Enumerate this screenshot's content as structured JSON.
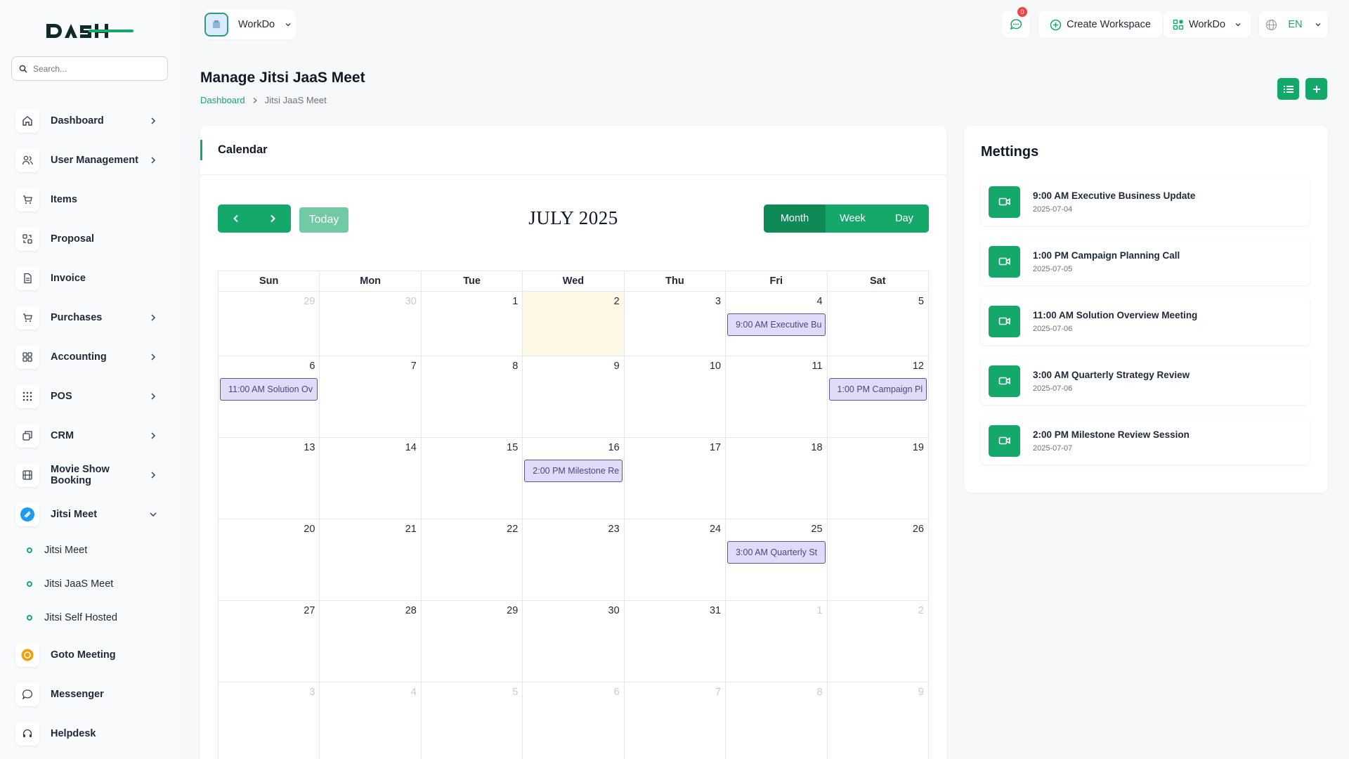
{
  "brand": {
    "logo_text": "DASH"
  },
  "sidebar": {
    "search_placeholder": "Search...",
    "items": [
      {
        "label": "Dashboard"
      },
      {
        "label": "User Management"
      },
      {
        "label": "Items"
      },
      {
        "label": "Proposal"
      },
      {
        "label": "Invoice"
      },
      {
        "label": "Purchases"
      },
      {
        "label": "Accounting"
      },
      {
        "label": "POS"
      },
      {
        "label": "CRM"
      },
      {
        "label": "Movie Show Booking"
      },
      {
        "label": "Jitsi Meet"
      },
      {
        "label": "Goto Meeting"
      },
      {
        "label": "Messenger"
      },
      {
        "label": "Helpdesk"
      }
    ],
    "sub_items": [
      {
        "label": "Jitsi Meet"
      },
      {
        "label": "Jitsi JaaS Meet"
      },
      {
        "label": "Jitsi Self Hosted"
      }
    ]
  },
  "topbar": {
    "workspace_label": "WorkDo",
    "notification_count": "0",
    "create_workspace_label": "Create Workspace",
    "workspace_menu_label": "WorkDo",
    "language_label": "EN"
  },
  "page": {
    "title": "Manage Jitsi JaaS Meet",
    "breadcrumb_home": "Dashboard",
    "breadcrumb_current": "Jitsi JaaS Meet"
  },
  "calendar": {
    "card_title": "Calendar",
    "today_label": "Today",
    "month_label": "JULY 2025",
    "views": [
      "Month",
      "Week",
      "Day"
    ],
    "active_view": "Month",
    "weekdays": [
      "Sun",
      "Mon",
      "Tue",
      "Wed",
      "Thu",
      "Fri",
      "Sat"
    ],
    "weeks": [
      [
        {
          "d": "29",
          "other": true
        },
        {
          "d": "30",
          "other": true
        },
        {
          "d": "1"
        },
        {
          "d": "2",
          "today": true
        },
        {
          "d": "3"
        },
        {
          "d": "4",
          "event": "9:00 AM Executive Bu"
        },
        {
          "d": "5"
        }
      ],
      [
        {
          "d": "6",
          "event": "11:00 AM Solution Ov"
        },
        {
          "d": "7"
        },
        {
          "d": "8"
        },
        {
          "d": "9"
        },
        {
          "d": "10"
        },
        {
          "d": "11"
        },
        {
          "d": "12",
          "event": "1:00 PM Campaign Pl"
        }
      ],
      [
        {
          "d": "13"
        },
        {
          "d": "14"
        },
        {
          "d": "15"
        },
        {
          "d": "16",
          "event": "2:00 PM Milestone Re"
        },
        {
          "d": "17"
        },
        {
          "d": "18"
        },
        {
          "d": "19"
        }
      ],
      [
        {
          "d": "20"
        },
        {
          "d": "21"
        },
        {
          "d": "22"
        },
        {
          "d": "23"
        },
        {
          "d": "24"
        },
        {
          "d": "25",
          "event": "3:00 AM Quarterly St"
        },
        {
          "d": "26"
        }
      ],
      [
        {
          "d": "27"
        },
        {
          "d": "28"
        },
        {
          "d": "29"
        },
        {
          "d": "30"
        },
        {
          "d": "31"
        },
        {
          "d": "1",
          "other": true
        },
        {
          "d": "2",
          "other": true
        }
      ],
      [
        {
          "d": "3",
          "other": true
        },
        {
          "d": "4",
          "other": true
        },
        {
          "d": "5",
          "other": true
        },
        {
          "d": "6",
          "other": true
        },
        {
          "d": "7",
          "other": true
        },
        {
          "d": "8",
          "other": true
        },
        {
          "d": "9",
          "other": true
        }
      ]
    ]
  },
  "meetings": {
    "title": "Mettings",
    "items": [
      {
        "name": "9:00 AM Executive Business Update",
        "date": "2025-07-04"
      },
      {
        "name": "1:00 PM Campaign Planning Call",
        "date": "2025-07-05"
      },
      {
        "name": "11:00 AM Solution Overview Meeting",
        "date": "2025-07-06"
      },
      {
        "name": "3:00 AM Quarterly Strategy Review",
        "date": "2025-07-06"
      },
      {
        "name": "2:00 PM Milestone Review Session",
        "date": "2025-07-07"
      }
    ]
  },
  "colors": {
    "accent": "#14a86b",
    "accent_dark": "#0e8a57",
    "event_bg": "#dfdcf7",
    "event_border": "#5b5298",
    "today_bg": "#fef9e7"
  }
}
